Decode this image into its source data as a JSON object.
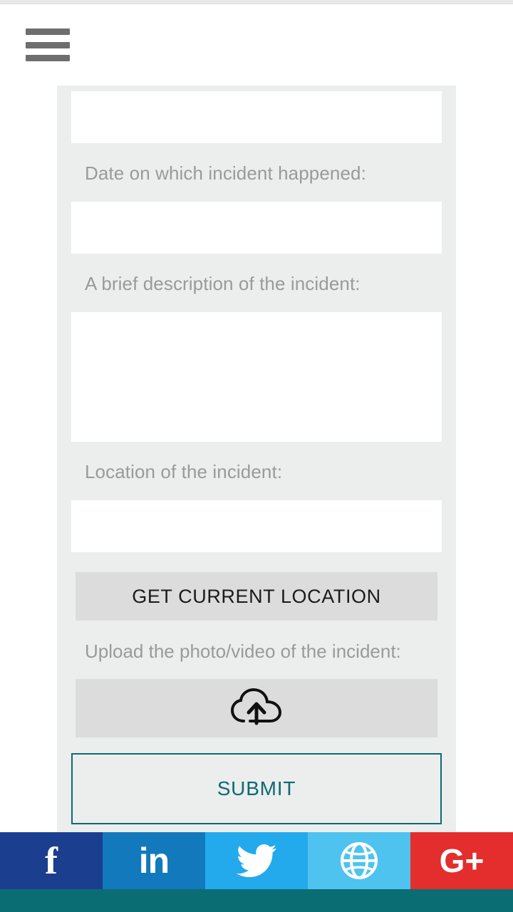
{
  "header": {
    "menu_icon": "hamburger-menu-icon"
  },
  "form": {
    "fields": [
      {
        "label": "",
        "value": "",
        "placeholder": "",
        "type": "text"
      },
      {
        "label": "Date on which incident happened:",
        "value": "",
        "placeholder": "",
        "type": "text"
      },
      {
        "label": "A brief description of the incident:",
        "value": "",
        "placeholder": "",
        "type": "textarea"
      },
      {
        "label": "Location of the incident:",
        "value": "",
        "placeholder": "",
        "type": "text"
      }
    ],
    "location_button": "GET CURRENT LOCATION",
    "upload_label": "Upload the photo/video of the incident:",
    "upload_icon": "cloud-upload-icon",
    "submit_button": "SUBMIT"
  },
  "social": [
    {
      "name": "facebook",
      "icon": "facebook-icon",
      "glyph": "f",
      "color": "#1b3f8e"
    },
    {
      "name": "linkedin",
      "icon": "linkedin-icon",
      "glyph": "in",
      "color": "#1279bc"
    },
    {
      "name": "twitter",
      "icon": "twitter-icon",
      "glyph": "",
      "color": "#23aaec"
    },
    {
      "name": "website",
      "icon": "globe-icon",
      "glyph": "",
      "color": "#4ec3f0"
    },
    {
      "name": "googleplus",
      "icon": "google-plus-icon",
      "glyph": "G+",
      "color": "#e42d2d"
    }
  ],
  "colors": {
    "accent": "#0c6b72",
    "card": "#eceded",
    "button": "#dcdcdc",
    "label": "#9a9a9a"
  }
}
